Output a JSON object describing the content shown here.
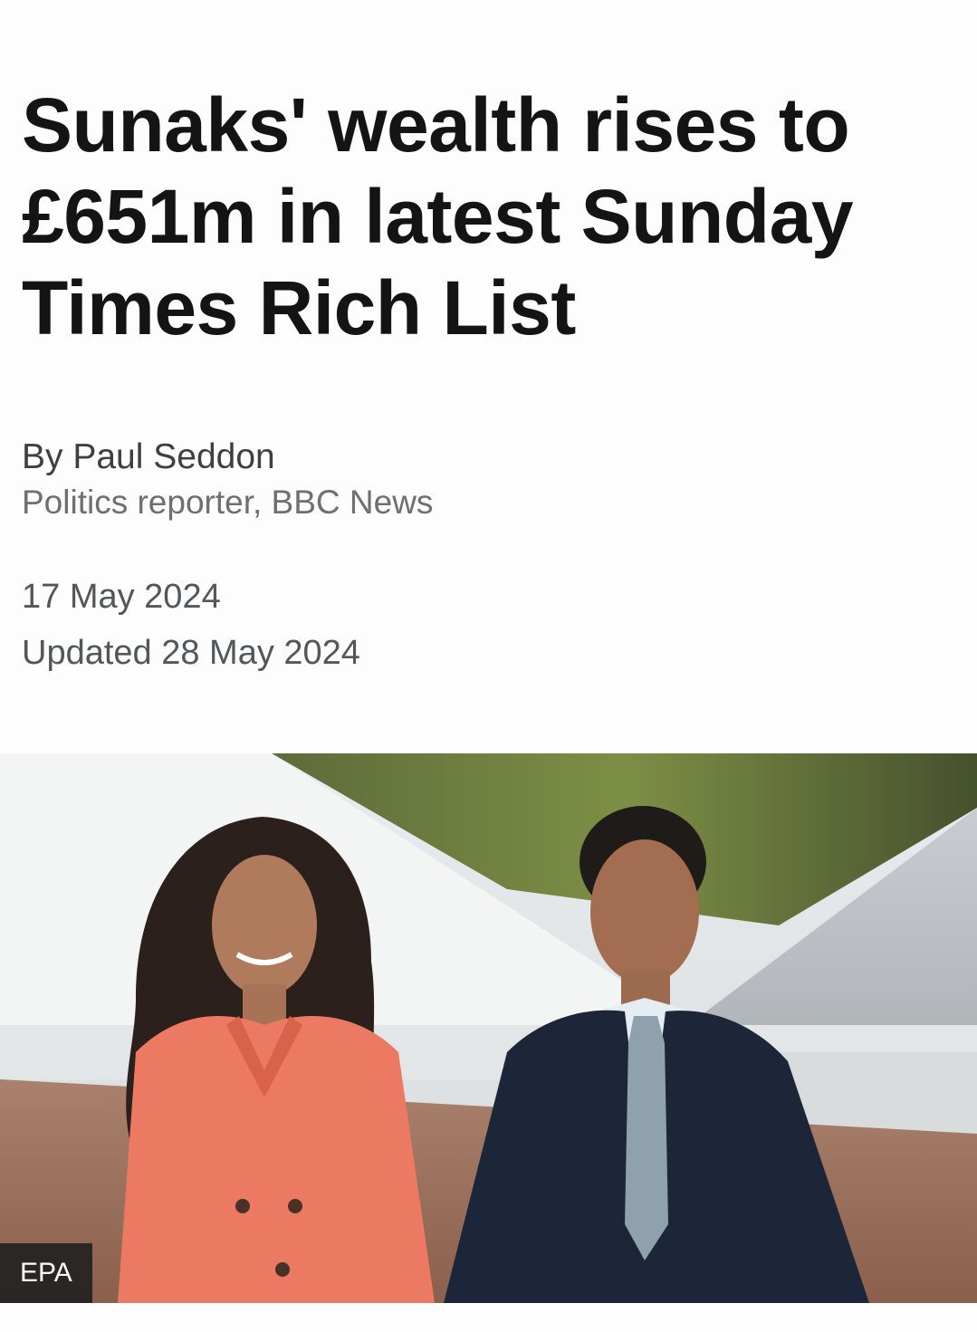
{
  "article": {
    "headline": "Sunaks' wealth rises to £651m in latest Sunday Times Rich List",
    "byline": {
      "author": "By Paul Seddon",
      "role": "Politics reporter, BBC News"
    },
    "published": "17 May 2024",
    "updated": "Updated 28 May 2024",
    "image": {
      "credit": "EPA",
      "depicts": "photo-of-couple-walking"
    }
  },
  "colors": {
    "text": "#141414",
    "secondary_text": "#545658",
    "background": "#fdfdfd",
    "credit_background": "#222222"
  }
}
